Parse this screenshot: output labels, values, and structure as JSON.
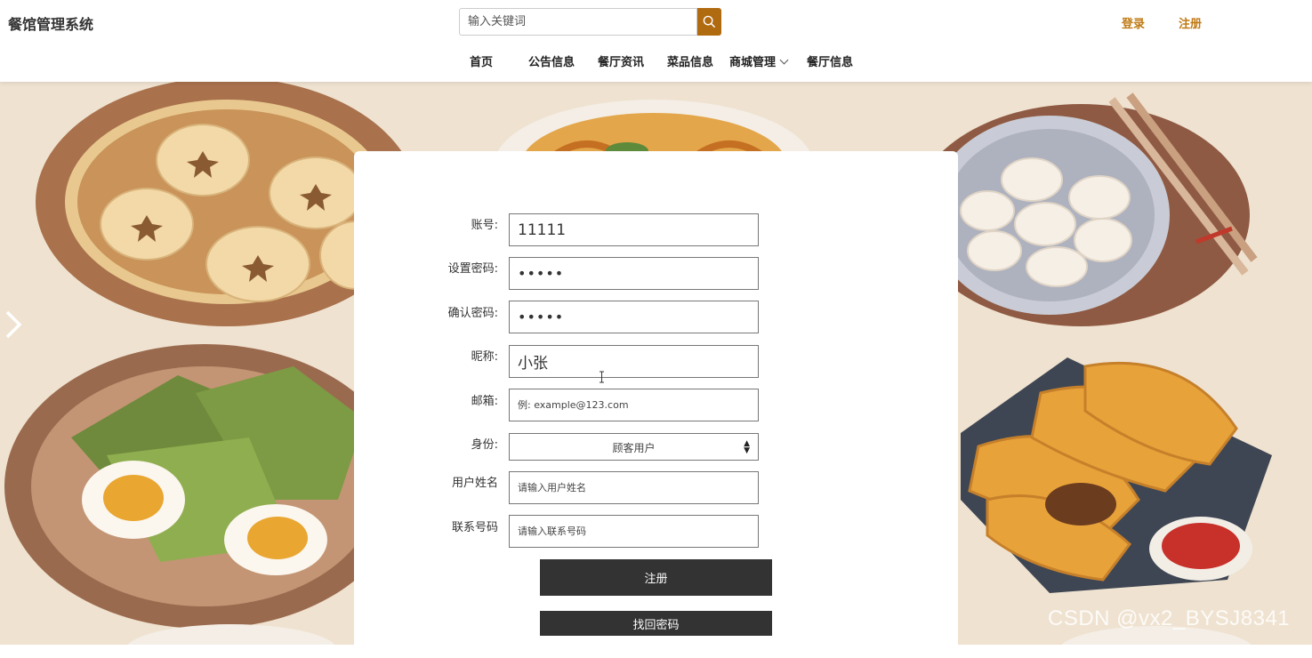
{
  "header": {
    "brand": "餐馆管理系统",
    "search_placeholder": "输入关键词",
    "login": "登录",
    "register": "注册"
  },
  "nav": {
    "home": "首页",
    "notice": "公告信息",
    "news": "餐厅资讯",
    "dishes": "菜品信息",
    "mall": "商城管理",
    "restaurant": "餐厅信息"
  },
  "form": {
    "account_label": "账号:",
    "account_value": "11111",
    "password_label": "设置密码:",
    "password_value": "12345",
    "confirm_label": "确认密码:",
    "confirm_value": "12345",
    "nickname_label": "昵称:",
    "nickname_value": "小张",
    "email_label": "邮箱:",
    "email_placeholder": "例: example@123.com",
    "role_label": "身份:",
    "role_value": "顾客用户",
    "username_label": "用户姓名",
    "username_placeholder": "请输入用户姓名",
    "phone_label": "联系号码",
    "phone_placeholder": "请输入联系号码",
    "register_button": "注册",
    "recover_button": "找回密码"
  },
  "watermark": "CSDN @vx2_BYSJ8341",
  "colors": {
    "accent": "#c07a14",
    "search_button": "#b06a10",
    "button_dark": "#333333",
    "hero_bg": "#efe2d0"
  }
}
